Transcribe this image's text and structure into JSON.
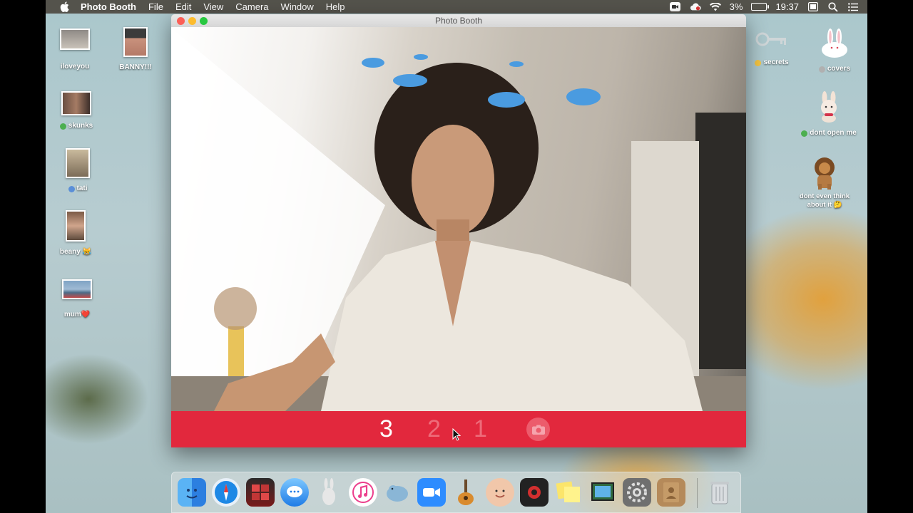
{
  "menubar": {
    "app_name": "Photo Booth",
    "menus": [
      "File",
      "Edit",
      "View",
      "Camera",
      "Window",
      "Help"
    ],
    "battery": "3%",
    "clock": "19:37"
  },
  "window": {
    "title": "Photo Booth",
    "countdown": [
      "3",
      "2",
      "1"
    ],
    "effect": "birds"
  },
  "desktop_left": [
    {
      "label": "iloveyou",
      "dot": null
    },
    {
      "label": "skunks",
      "dot": "#4caf50"
    },
    {
      "label": "tati",
      "dot": "#5a8fd8"
    },
    {
      "label": "beany 😹",
      "dot": null
    },
    {
      "label": "mum❤️",
      "dot": null
    }
  ],
  "desktop_left2": [
    {
      "label": "BANNY!!!",
      "dot": null
    }
  ],
  "desktop_right": [
    {
      "label": "secrets",
      "dot": "#f5c542"
    },
    {
      "label": "covers",
      "dot": "#b0b0b0"
    },
    {
      "label": "dont open me",
      "dot": "#4caf50"
    },
    {
      "label": "dont even think about it 🤔",
      "dot": "#e04a5a"
    }
  ],
  "dock": {
    "apps": [
      "finder-icon",
      "safari-icon",
      "photo-booth-icon",
      "messages-icon",
      "launchpad-icon",
      "itunes-icon",
      "sequel-icon",
      "zoom-icon",
      "garageband-icon",
      "face-app-icon",
      "photo-app-icon",
      "stickies-icon",
      "preview-icon",
      "system-preferences-icon",
      "contacts-icon",
      "trash-icon"
    ]
  }
}
